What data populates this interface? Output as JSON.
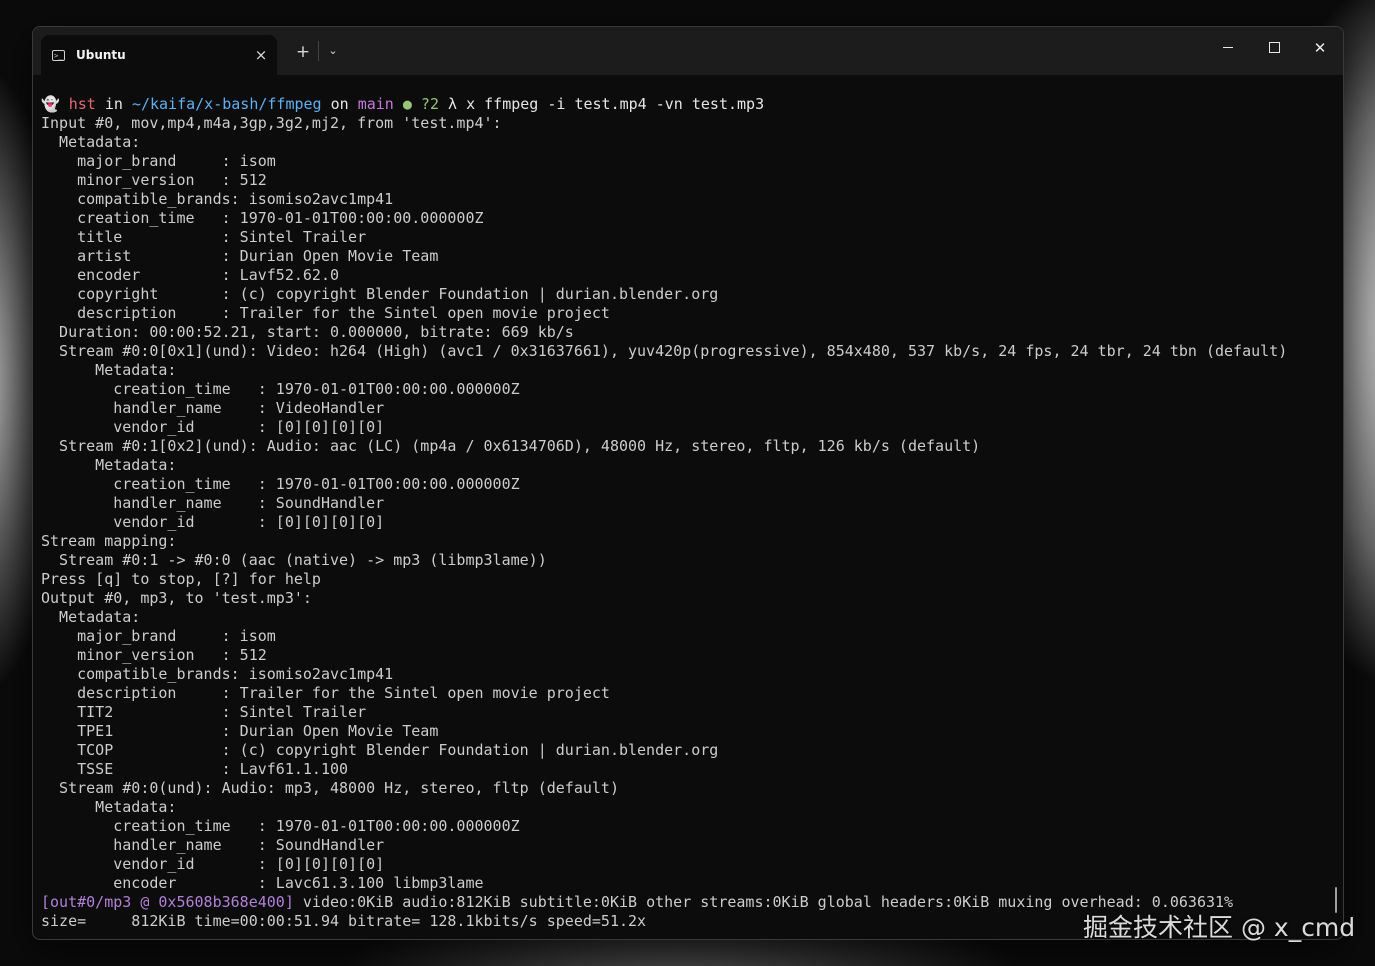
{
  "window": {
    "tab_title": "Ubuntu",
    "tab_icon": "terminal-icon",
    "tab_close": "×",
    "new_tab": "+",
    "dropdown": "⌄",
    "minimize": "—",
    "close": "✕"
  },
  "prompt": {
    "icon": "ghost-icon",
    "user": "hst",
    "in": " in ",
    "path": "~/kaifa/x-bash/ffmpeg",
    "on": " on ",
    "branch": "main",
    "status": " ● ?2",
    "symbol": " λ x ",
    "command": "ffmpeg -i test.mp4 -vn test.mp3"
  },
  "output_lines": [
    "Input #0, mov,mp4,m4a,3gp,3g2,mj2, from 'test.mp4':",
    "  Metadata:",
    "    major_brand     : isom",
    "    minor_version   : 512",
    "    compatible_brands: isomiso2avc1mp41",
    "    creation_time   : 1970-01-01T00:00:00.000000Z",
    "    title           : Sintel Trailer",
    "    artist          : Durian Open Movie Team",
    "    encoder         : Lavf52.62.0",
    "    copyright       : (c) copyright Blender Foundation | durian.blender.org",
    "    description     : Trailer for the Sintel open movie project",
    "  Duration: 00:00:52.21, start: 0.000000, bitrate: 669 kb/s",
    "  Stream #0:0[0x1](und): Video: h264 (High) (avc1 / 0x31637661), yuv420p(progressive), 854x480, 537 kb/s, 24 fps, 24 tbr, 24 tbn (default)",
    "      Metadata:",
    "        creation_time   : 1970-01-01T00:00:00.000000Z",
    "        handler_name    : VideoHandler",
    "        vendor_id       : [0][0][0][0]",
    "  Stream #0:1[0x2](und): Audio: aac (LC) (mp4a / 0x6134706D), 48000 Hz, stereo, fltp, 126 kb/s (default)",
    "      Metadata:",
    "        creation_time   : 1970-01-01T00:00:00.000000Z",
    "        handler_name    : SoundHandler",
    "        vendor_id       : [0][0][0][0]",
    "Stream mapping:",
    "  Stream #0:1 -> #0:0 (aac (native) -> mp3 (libmp3lame))",
    "Press [q] to stop, [?] for help",
    "Output #0, mp3, to 'test.mp3':",
    "  Metadata:",
    "    major_brand     : isom",
    "    minor_version   : 512",
    "    compatible_brands: isomiso2avc1mp41",
    "    description     : Trailer for the Sintel open movie project",
    "    TIT2            : Sintel Trailer",
    "    TPE1            : Durian Open Movie Team",
    "    TCOP            : (c) copyright Blender Foundation | durian.blender.org",
    "    TSSE            : Lavf61.1.100",
    "  Stream #0:0(und): Audio: mp3, 48000 Hz, stereo, fltp (default)",
    "      Metadata:",
    "        creation_time   : 1970-01-01T00:00:00.000000Z",
    "        handler_name    : SoundHandler",
    "        vendor_id       : [0][0][0][0]",
    "        encoder         : Lavc61.3.100 libmp3lame"
  ],
  "final": {
    "tag": "[out#0/mp3 @ 0x5608b368e400]",
    "summary": " video:0KiB audio:812KiB subtitle:0KiB other streams:0KiB global headers:0KiB muxing overhead: 0.063631%",
    "size_line": "size=     812KiB time=00:00:51.94 bitrate= 128.1kbits/s speed=51.2x"
  },
  "watermark": "掘金技术社区 @ x_cmd",
  "colors": {
    "user": "#e06c75",
    "path": "#61afef",
    "branch": "#c678dd",
    "status": "#98c379",
    "tag": "#b180d7",
    "text": "#cccccc"
  }
}
